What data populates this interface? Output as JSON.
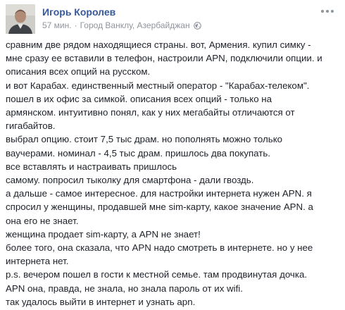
{
  "post": {
    "author": "Игорь Королев",
    "timestamp": "57 мин.",
    "separator": "·",
    "location": "Город Ванклу, Азербайджан",
    "privacy_icon": "globe-icon",
    "more_icon": "more-options-icon",
    "lines": [
      "сравним две рядом находящиеся страны. вот, Армения. купил симку -",
      "мне сразу ее вставили в телефон, настроили APN, подключили опции. и",
      "описания всех опций на русском.",
      "и вот Карабах. единственный местный оператор - \"Карабах-телеком\".",
      "пошел в их офис за симкой. описания всех опций - только на",
      "армянском. интуитивно понял, как у них мегабайты отличаются от",
      "гигабайтов.",
      "выбрал опцию. стоит 7,5 тыс драм. но пополнять можно только",
      "ваучерами. номинал - 4,5 тыс драм. пришлось два покупать.",
      "все вставлять и настраивать пришлось",
      "самому. попросил тыколку для смартфона - дали гвоздь.",
      "а дальше - самое интересное. для настройки интернета нужен APN. я",
      "спросил у женщины, продавшей мне sim-карту, какое значение APN. а",
      "она его не знает.",
      "женщина продает sim-карту, а APN не знает!",
      "более того, она сказала, что APN надо смотреть в интернете. но у нее",
      "интернета нет.",
      "p.s. вечером пошел в гости к местной семье. там продвинутая дочка.",
      "APN она, правда, не знала, но знала пароль от их wifi.",
      "так удалось выйти в интернет и узнать apn."
    ]
  },
  "colors": {
    "author_link": "#365899",
    "meta_text": "#90949c",
    "body_text": "#1d2129",
    "background": "#ffffff"
  }
}
